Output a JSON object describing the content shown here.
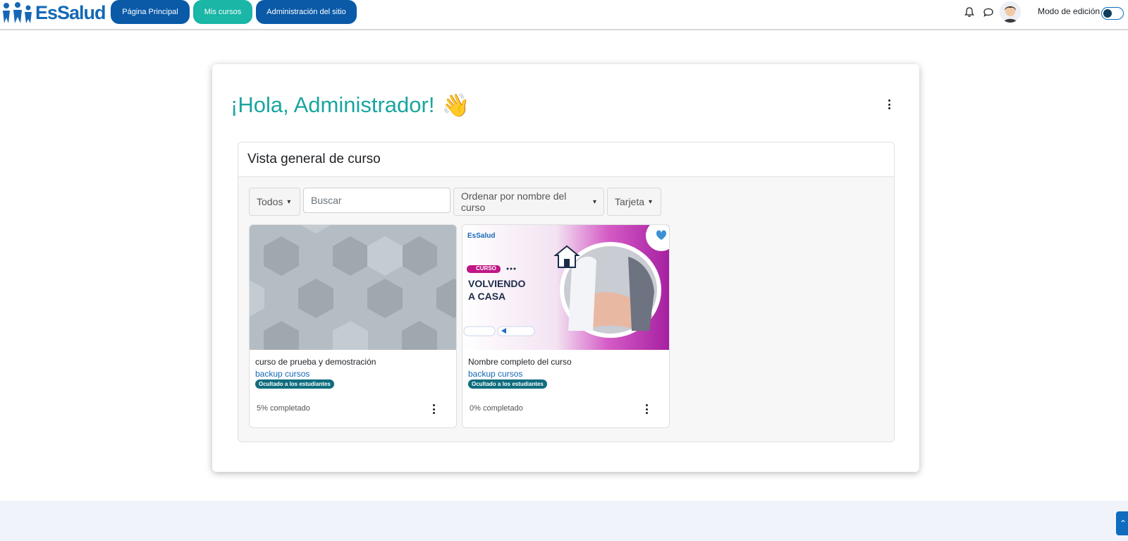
{
  "brand": {
    "logo_text": "EsSalud",
    "primary_color": "#0a5aa8",
    "accent_color": "#1ab6a6"
  },
  "nav": {
    "items": [
      {
        "label": "Página Principal",
        "active": false
      },
      {
        "label": "Mis cursos",
        "active": true
      },
      {
        "label": "Administración del sitio",
        "active": false
      }
    ],
    "notifications_icon": "bell-icon",
    "messages_icon": "chat-bubble-icon",
    "edit_mode_label": "Modo de edición",
    "edit_mode_on": false
  },
  "greeting": {
    "text": "¡Hola, Administrador!",
    "emoji": "👋"
  },
  "course_overview": {
    "title": "Vista general de curso",
    "filter": {
      "selected": "Todos"
    },
    "search": {
      "placeholder": "Buscar",
      "value": ""
    },
    "sort": {
      "selected": "Ordenar por nombre del curso"
    },
    "view": {
      "selected": "Tarjeta"
    },
    "courses": [
      {
        "name": "curso de prueba y demostración",
        "category": "backup cursos",
        "badge": "Ocultado a los estudiantes",
        "progress_text": "5% completado",
        "progress": 5
      },
      {
        "name": "Nombre completo del curso",
        "category": "backup cursos",
        "badge": "Ocultado a los estudiantes",
        "progress_text": "0% completado",
        "progress": 0,
        "image_text": {
          "logo": "EsSalud",
          "tag": "CURSO",
          "title_line1": "VOLVIENDO",
          "title_line2": "A CASA"
        }
      }
    ]
  }
}
